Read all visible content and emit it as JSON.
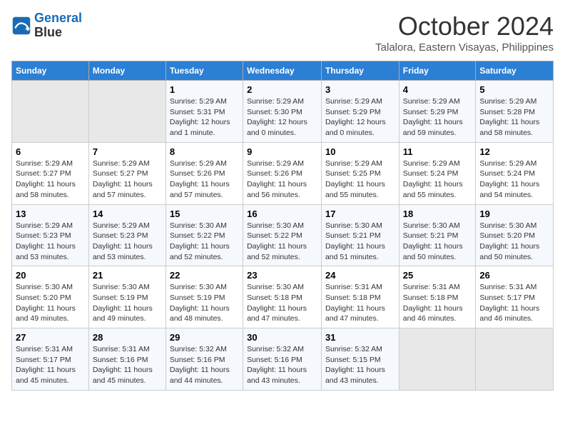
{
  "header": {
    "logo_line1": "General",
    "logo_line2": "Blue",
    "month": "October 2024",
    "location": "Talalora, Eastern Visayas, Philippines"
  },
  "weekdays": [
    "Sunday",
    "Monday",
    "Tuesday",
    "Wednesday",
    "Thursday",
    "Friday",
    "Saturday"
  ],
  "weeks": [
    [
      {
        "day": "",
        "empty": true
      },
      {
        "day": "",
        "empty": true
      },
      {
        "day": "1",
        "sunrise": "5:29 AM",
        "sunset": "5:31 PM",
        "daylight": "12 hours and 1 minute."
      },
      {
        "day": "2",
        "sunrise": "5:29 AM",
        "sunset": "5:30 PM",
        "daylight": "12 hours and 0 minutes."
      },
      {
        "day": "3",
        "sunrise": "5:29 AM",
        "sunset": "5:29 PM",
        "daylight": "12 hours and 0 minutes."
      },
      {
        "day": "4",
        "sunrise": "5:29 AM",
        "sunset": "5:29 PM",
        "daylight": "11 hours and 59 minutes."
      },
      {
        "day": "5",
        "sunrise": "5:29 AM",
        "sunset": "5:28 PM",
        "daylight": "11 hours and 58 minutes."
      }
    ],
    [
      {
        "day": "6",
        "sunrise": "5:29 AM",
        "sunset": "5:27 PM",
        "daylight": "11 hours and 58 minutes."
      },
      {
        "day": "7",
        "sunrise": "5:29 AM",
        "sunset": "5:27 PM",
        "daylight": "11 hours and 57 minutes."
      },
      {
        "day": "8",
        "sunrise": "5:29 AM",
        "sunset": "5:26 PM",
        "daylight": "11 hours and 57 minutes."
      },
      {
        "day": "9",
        "sunrise": "5:29 AM",
        "sunset": "5:26 PM",
        "daylight": "11 hours and 56 minutes."
      },
      {
        "day": "10",
        "sunrise": "5:29 AM",
        "sunset": "5:25 PM",
        "daylight": "11 hours and 55 minutes."
      },
      {
        "day": "11",
        "sunrise": "5:29 AM",
        "sunset": "5:24 PM",
        "daylight": "11 hours and 55 minutes."
      },
      {
        "day": "12",
        "sunrise": "5:29 AM",
        "sunset": "5:24 PM",
        "daylight": "11 hours and 54 minutes."
      }
    ],
    [
      {
        "day": "13",
        "sunrise": "5:29 AM",
        "sunset": "5:23 PM",
        "daylight": "11 hours and 53 minutes."
      },
      {
        "day": "14",
        "sunrise": "5:29 AM",
        "sunset": "5:23 PM",
        "daylight": "11 hours and 53 minutes."
      },
      {
        "day": "15",
        "sunrise": "5:30 AM",
        "sunset": "5:22 PM",
        "daylight": "11 hours and 52 minutes."
      },
      {
        "day": "16",
        "sunrise": "5:30 AM",
        "sunset": "5:22 PM",
        "daylight": "11 hours and 52 minutes."
      },
      {
        "day": "17",
        "sunrise": "5:30 AM",
        "sunset": "5:21 PM",
        "daylight": "11 hours and 51 minutes."
      },
      {
        "day": "18",
        "sunrise": "5:30 AM",
        "sunset": "5:21 PM",
        "daylight": "11 hours and 50 minutes."
      },
      {
        "day": "19",
        "sunrise": "5:30 AM",
        "sunset": "5:20 PM",
        "daylight": "11 hours and 50 minutes."
      }
    ],
    [
      {
        "day": "20",
        "sunrise": "5:30 AM",
        "sunset": "5:20 PM",
        "daylight": "11 hours and 49 minutes."
      },
      {
        "day": "21",
        "sunrise": "5:30 AM",
        "sunset": "5:19 PM",
        "daylight": "11 hours and 49 minutes."
      },
      {
        "day": "22",
        "sunrise": "5:30 AM",
        "sunset": "5:19 PM",
        "daylight": "11 hours and 48 minutes."
      },
      {
        "day": "23",
        "sunrise": "5:30 AM",
        "sunset": "5:18 PM",
        "daylight": "11 hours and 47 minutes."
      },
      {
        "day": "24",
        "sunrise": "5:31 AM",
        "sunset": "5:18 PM",
        "daylight": "11 hours and 47 minutes."
      },
      {
        "day": "25",
        "sunrise": "5:31 AM",
        "sunset": "5:18 PM",
        "daylight": "11 hours and 46 minutes."
      },
      {
        "day": "26",
        "sunrise": "5:31 AM",
        "sunset": "5:17 PM",
        "daylight": "11 hours and 46 minutes."
      }
    ],
    [
      {
        "day": "27",
        "sunrise": "5:31 AM",
        "sunset": "5:17 PM",
        "daylight": "11 hours and 45 minutes."
      },
      {
        "day": "28",
        "sunrise": "5:31 AM",
        "sunset": "5:16 PM",
        "daylight": "11 hours and 45 minutes."
      },
      {
        "day": "29",
        "sunrise": "5:32 AM",
        "sunset": "5:16 PM",
        "daylight": "11 hours and 44 minutes."
      },
      {
        "day": "30",
        "sunrise": "5:32 AM",
        "sunset": "5:16 PM",
        "daylight": "11 hours and 43 minutes."
      },
      {
        "day": "31",
        "sunrise": "5:32 AM",
        "sunset": "5:15 PM",
        "daylight": "11 hours and 43 minutes."
      },
      {
        "day": "",
        "empty": true
      },
      {
        "day": "",
        "empty": true
      }
    ]
  ]
}
